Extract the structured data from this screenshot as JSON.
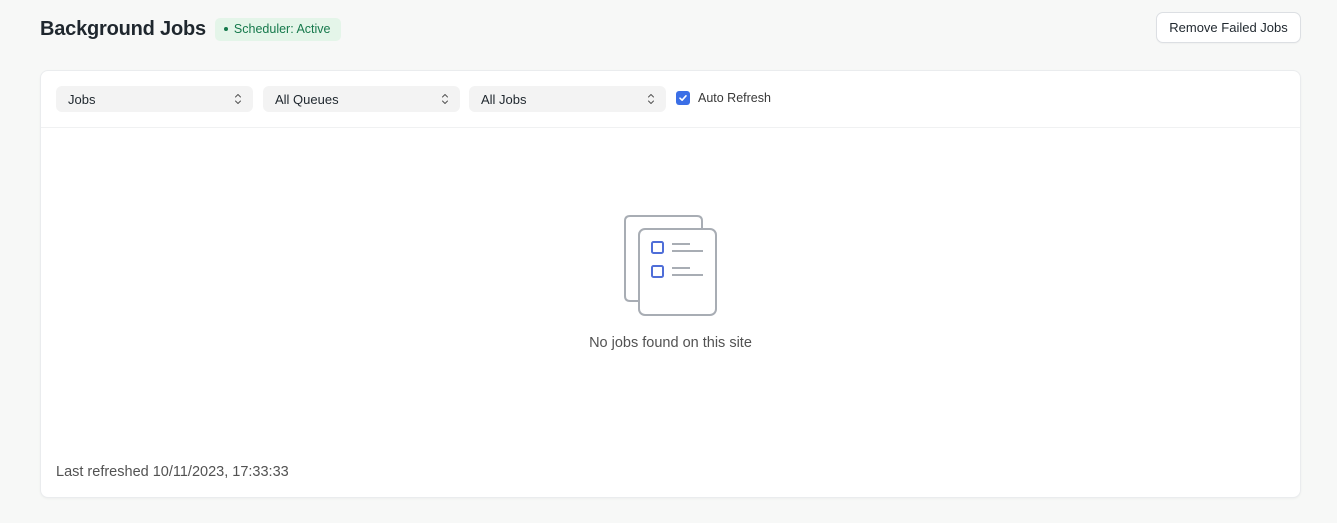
{
  "header": {
    "title": "Background Jobs",
    "status_badge": "Scheduler: Active",
    "remove_button_label": "Remove Failed Jobs"
  },
  "filters": {
    "view_select": "Jobs",
    "queue_select": "All Queues",
    "status_select": "All Jobs",
    "auto_refresh_label": "Auto Refresh",
    "auto_refresh_checked": true
  },
  "empty_state": {
    "message": "No jobs found on this site",
    "icon": "document-checklist-icon"
  },
  "footer": {
    "last_refreshed": "Last refreshed 10/11/2023, 17:33:33"
  },
  "colors": {
    "accent": "#3b6fe6",
    "badge_bg": "#e4f5e9",
    "badge_text": "#16794c",
    "page_bg": "#f7f8f7"
  }
}
